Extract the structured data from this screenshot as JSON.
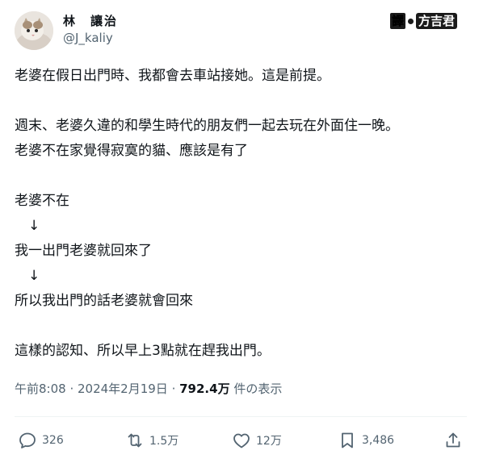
{
  "author": {
    "display_name": "林　讓治",
    "handle": "@J_kaliy",
    "avatar_icon": "cat-avatar"
  },
  "translator": {
    "tag": "譯",
    "name": "方吉君"
  },
  "body": {
    "lines": [
      "老婆在假日出門時、我都會去車站接她。這是前提。",
      "",
      "週末、老婆久違的和學生時代的朋友們一起去玩在外面住一晚。",
      "老婆不在家覺得寂寞的貓、應該是有了",
      "",
      "老婆不在",
      "　↓",
      "我一出門老婆就回來了",
      "　↓",
      "所以我出門的話老婆就會回來",
      "",
      "這樣的認知、所以早上3點就在趕我出門。"
    ]
  },
  "meta": {
    "time": "午前8:08",
    "separator": " · ",
    "date": "2024年2月19日",
    "separator2": " · ",
    "views": "792.4万",
    "views_label": " 件の表示"
  },
  "actions": {
    "reply_count": "326",
    "retweet_count": "1.5万",
    "like_count": "12万",
    "bookmark_count": "3,486"
  },
  "colors": {
    "text": "#0f1419",
    "secondary": "#536471",
    "divider": "#eff3f4"
  }
}
